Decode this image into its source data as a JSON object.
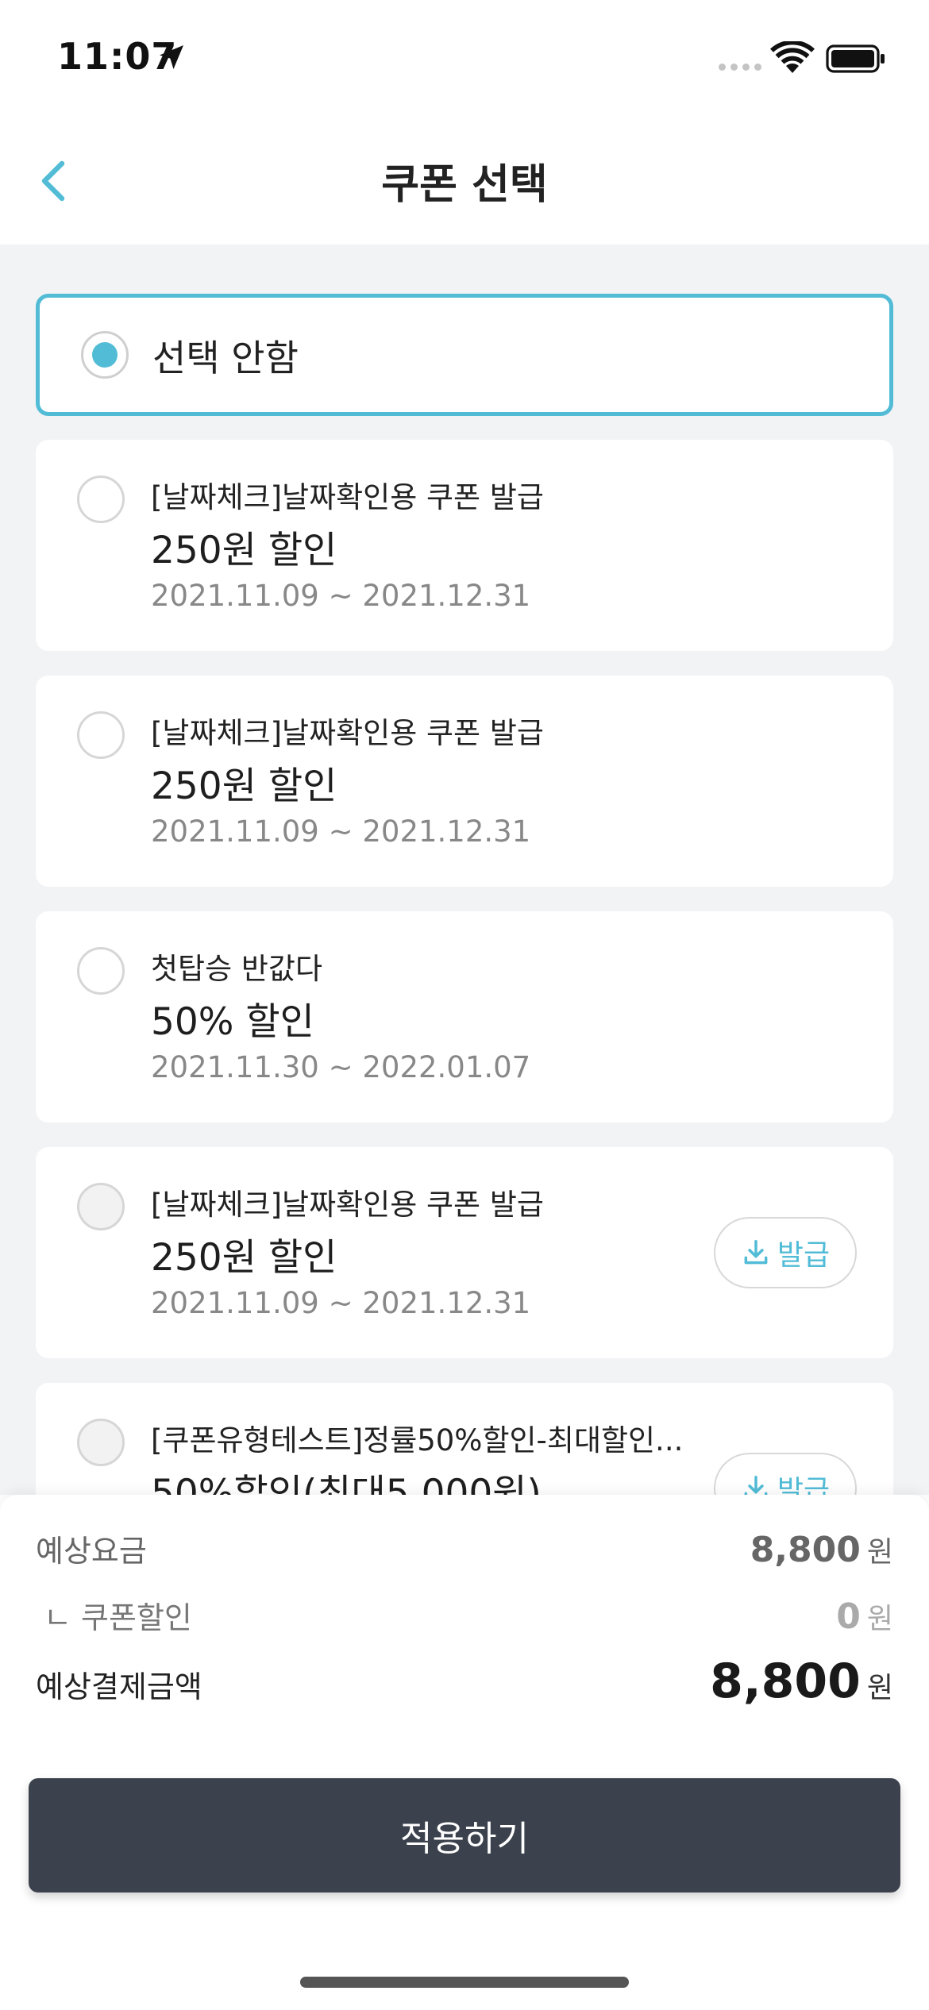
{
  "status_bar": {
    "time": "11:07"
  },
  "header": {
    "title": "쿠폰 선택"
  },
  "options": {
    "none_label": "선택 안함"
  },
  "coupons": [
    {
      "name": "[날짜체크]날짜확인용 쿠폰 발급",
      "discount": "250원 할인",
      "period": "2021.11.09 ~ 2021.12.31",
      "issue_label": ""
    },
    {
      "name": "[날짜체크]날짜확인용 쿠폰 발급",
      "discount": "250원 할인",
      "period": "2021.11.09 ~ 2021.12.31",
      "issue_label": ""
    },
    {
      "name": "첫탑승 반값다",
      "discount": "50% 할인",
      "period": "2021.11.30 ~ 2022.01.07",
      "issue_label": ""
    },
    {
      "name": "[날짜체크]날짜확인용 쿠폰 발급",
      "discount": "250원 할인",
      "period": "2021.11.09 ~ 2021.12.31",
      "issue_label": "발급"
    },
    {
      "name": "[쿠폰유형테스트]정률50%할인-최대할인...",
      "discount": "50%할인(최대5,000원)",
      "period": "",
      "issue_label": "발급"
    }
  ],
  "summary": {
    "expected_fare_label": "예상요금",
    "expected_fare_value": "8,800",
    "coupon_discount_label": "ㄴ 쿠폰할인",
    "coupon_discount_value": "0",
    "expected_payment_label": "예상결제금액",
    "expected_payment_value": "8,800",
    "unit": "원"
  },
  "apply_button": {
    "label": "적용하기"
  },
  "colors": {
    "accent": "#52bcd6",
    "button_dark": "#3c424d",
    "background": "#f2f3f5"
  }
}
